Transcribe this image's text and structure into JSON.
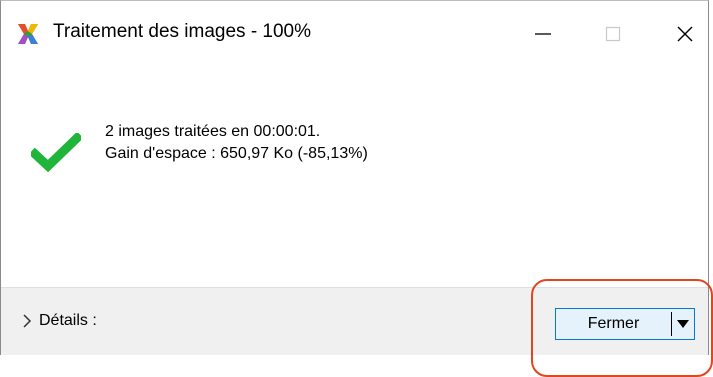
{
  "window": {
    "title": "Traitement des images - 100%",
    "icon": "app-multicolor-icon",
    "controls": {
      "minimize": "minimize-icon",
      "maximize": "maximize-icon",
      "close": "close-icon"
    }
  },
  "result": {
    "icon": "checkmark-icon",
    "icon_color": "#21b43a",
    "line1": "2 images traitées en 00:00:01.",
    "line2": "Gain d'espace : 650,97 Ko (-85,13%)"
  },
  "footer": {
    "details_label": "Détails :",
    "close_button_label": "Fermer"
  },
  "colors": {
    "button_border": "#0078d7",
    "button_bg": "#e5f1fb",
    "footer_bg": "#f0f0f0",
    "annotation": "#e2461e"
  }
}
